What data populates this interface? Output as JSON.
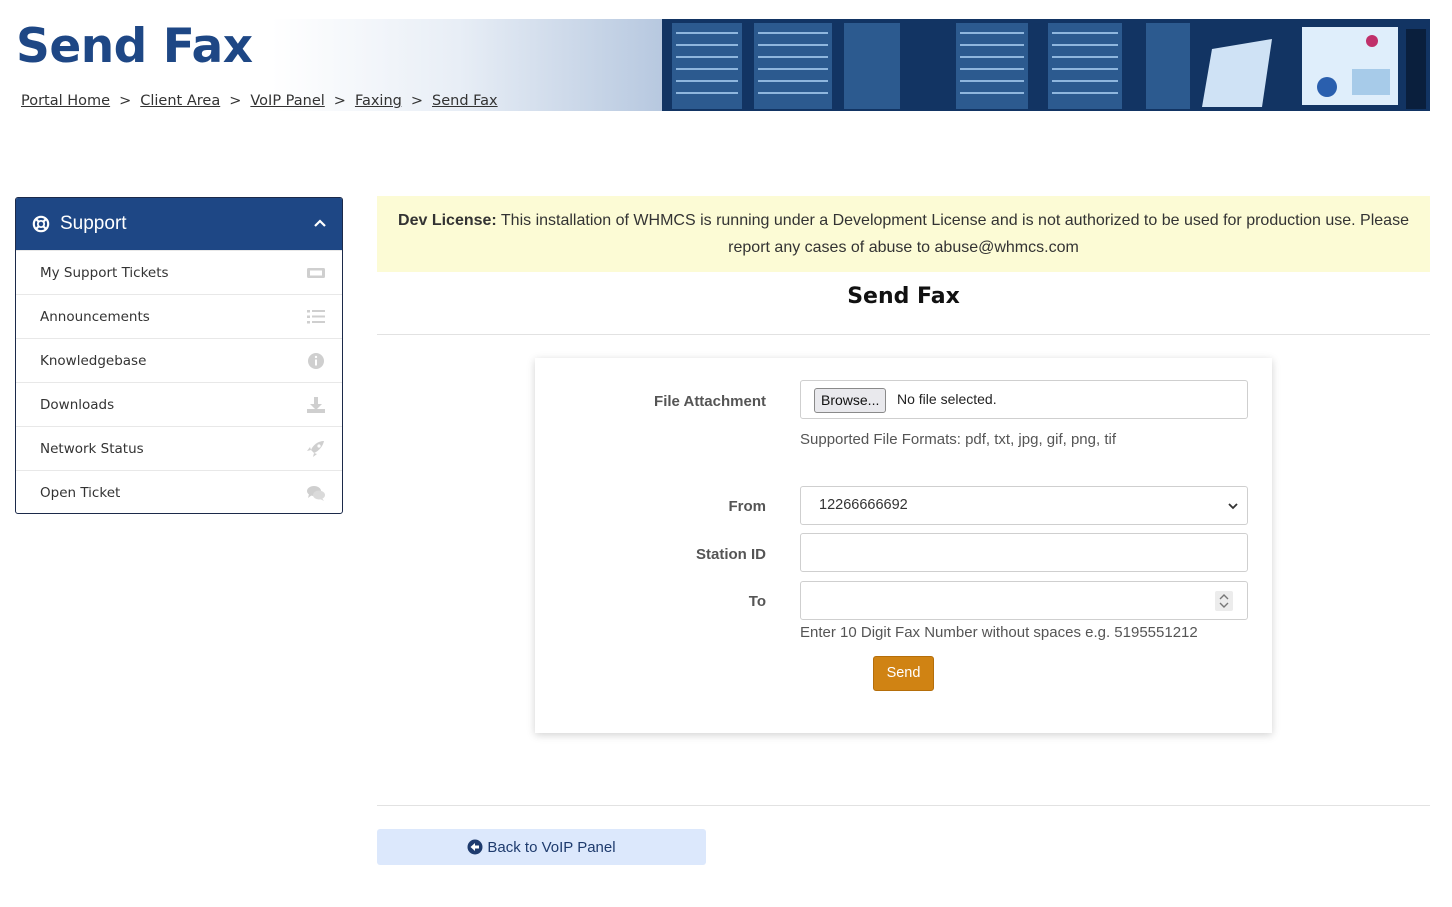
{
  "header": {
    "title": "Send Fax",
    "breadcrumb": [
      "Portal Home",
      "Client Area",
      "VoIP Panel",
      "Faxing",
      "Send Fax"
    ],
    "separator": ">"
  },
  "sidebar": {
    "title": "Support",
    "items": [
      {
        "label": "My Support Tickets",
        "icon": "ticket-icon"
      },
      {
        "label": "Announcements",
        "icon": "list-icon"
      },
      {
        "label": "Knowledgebase",
        "icon": "info-icon"
      },
      {
        "label": "Downloads",
        "icon": "download-icon"
      },
      {
        "label": "Network Status",
        "icon": "rocket-icon"
      },
      {
        "label": "Open Ticket",
        "icon": "comments-icon"
      }
    ]
  },
  "banner": {
    "bold": "Dev License:",
    "text": " This installation of WHMCS is running under a Development License and is not authorized to be used for production use. Please report any cases of abuse to abuse@whmcs.com"
  },
  "form": {
    "title": "Send Fax",
    "file_label": "File Attachment",
    "browse_label": "Browse...",
    "no_file": "No file selected.",
    "file_help": "Supported File Formats: pdf, txt, jpg, gif, png, tif",
    "from_label": "From",
    "from_value": "12266666692",
    "station_label": "Station ID",
    "station_value": "",
    "to_label": "To",
    "to_value": "",
    "to_help": "Enter 10 Digit Fax Number without spaces e.g. 5195551212",
    "send_label": "Send"
  },
  "footer": {
    "back_label": "Back to VoIP Panel"
  },
  "colors": {
    "brand": "#1e4785",
    "send": "#d08313",
    "banner_bg": "#fcfbd5",
    "back_bg": "#dce8fc"
  }
}
